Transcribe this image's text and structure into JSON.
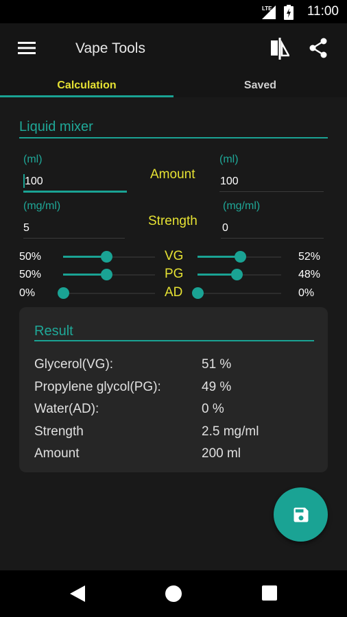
{
  "status_bar": {
    "network": "LTE",
    "time": "11:00"
  },
  "app_bar": {
    "title": "Vape Tools"
  },
  "tabs": [
    {
      "label": "Calculation",
      "selected": true
    },
    {
      "label": "Saved",
      "selected": false
    }
  ],
  "mixer": {
    "title": "Liquid mixer",
    "amount": {
      "label": "Amount",
      "unit_left": "(ml)",
      "unit_right": "(ml)",
      "value_left": "100",
      "value_right": "100"
    },
    "strength": {
      "label": "Strength",
      "unit_left": "(mg/ml)",
      "unit_right": "(mg/ml)",
      "value_left": "5",
      "value_right": "0"
    },
    "sliders": [
      {
        "label": "VG",
        "left_pct": "50%",
        "right_pct": "52%",
        "left_value": 50,
        "right_value": 52
      },
      {
        "label": "PG",
        "left_pct": "50%",
        "right_pct": "48%",
        "left_value": 50,
        "right_value": 48
      },
      {
        "label": "AD",
        "left_pct": "0%",
        "right_pct": "0%",
        "left_value": 0,
        "right_value": 0
      }
    ]
  },
  "result": {
    "title": "Result",
    "rows": [
      {
        "label": "Glycerol(VG):",
        "value": "51 %"
      },
      {
        "label": "Propylene glycol(PG):",
        "value": "49 %"
      },
      {
        "label": "Water(AD):",
        "value": "0 %"
      },
      {
        "label": "Strength",
        "value": "2.5 mg/ml"
      },
      {
        "label": "Amount",
        "value": "200 ml"
      }
    ]
  },
  "colors": {
    "accent": "#1aa394",
    "label_yellow": "#e6e233",
    "background": "#191919",
    "card": "#262626"
  },
  "icons": {
    "menu": "hamburger-menu-icon",
    "swap": "swap-icon",
    "share": "share-icon",
    "save": "save-floppy-icon"
  }
}
